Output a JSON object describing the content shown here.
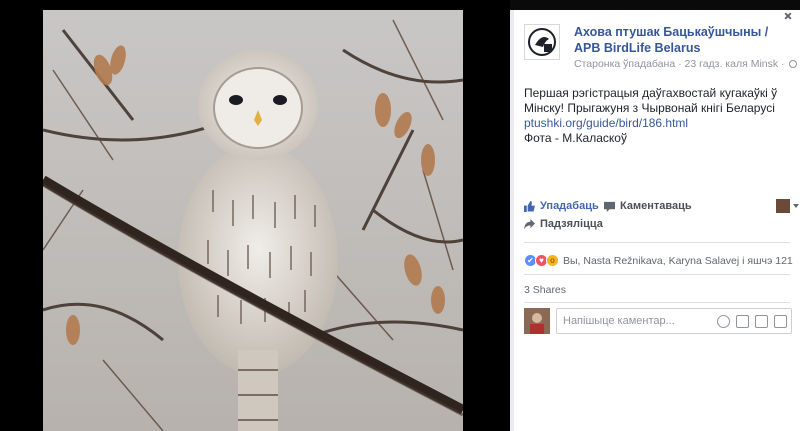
{
  "page": {
    "name": "Ахова птушак Бацькаўшчыны / АРВ BirdLife Belarus",
    "meta": "Старонка ўпадабана · 23 гадз. каля Minsk ·"
  },
  "post": {
    "line1": "Першая рэгістрацыя даўгахвостай кугакаўкі ў Мінску! Прыгажуня з Чырвонай кнігі Беларусі",
    "link": "ptushki.org/guide/bird/186.html",
    "credit": "Фота - М.Каласкоў"
  },
  "actions": {
    "like": "Упадабаць",
    "comment": "Каментаваць",
    "share": "Падзяліцца"
  },
  "reactions": {
    "text": "Вы, Nasta Režnikava, Karyna Salavej і яшчэ 121"
  },
  "shares": "3 Shares",
  "comment": {
    "placeholder": "Напішыце каментар..."
  },
  "icons": {
    "close": "close-icon",
    "globe": "globe-icon",
    "like": "thumbs-up-icon",
    "comment": "speech-bubble-icon",
    "share": "share-arrow-icon",
    "emoji": "emoji-icon",
    "camera": "camera-icon",
    "gif": "gif-icon",
    "sticker": "sticker-icon"
  },
  "colors": {
    "link": "#365899",
    "like_active": "#4267b2",
    "text": "#1d2129",
    "meta": "#90949c"
  }
}
